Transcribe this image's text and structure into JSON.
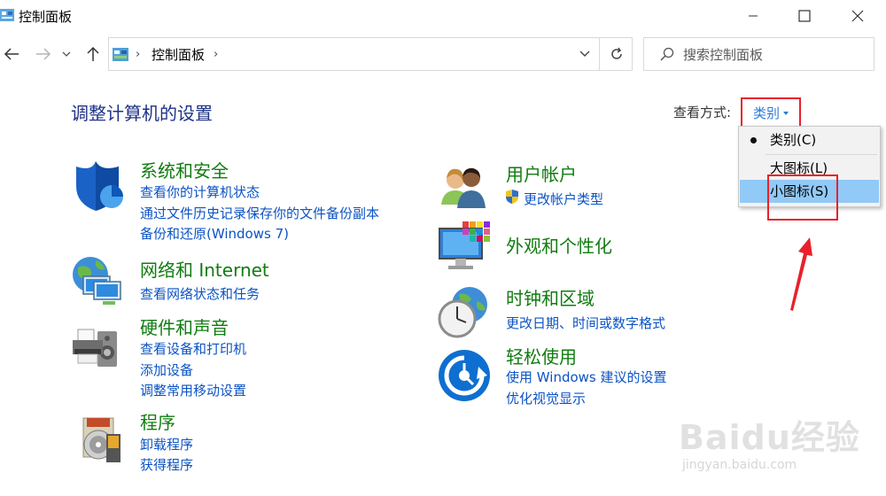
{
  "window": {
    "title": "控制面板"
  },
  "address": {
    "path": "控制面板",
    "search_placeholder": "搜索控制面板"
  },
  "header": {
    "title": "调整计算机的设置",
    "view_by_label": "查看方式:",
    "view_by_value": "类别"
  },
  "view_menu": {
    "items": [
      {
        "label": "类别(C)",
        "checked": true
      },
      {
        "label": "大图标(L)",
        "checked": false
      },
      {
        "label": "小图标(S)",
        "checked": false,
        "hovered": true
      }
    ]
  },
  "categories_left": [
    {
      "title": "系统和安全",
      "icon": "shield-icon",
      "links": [
        "查看你的计算机状态",
        "通过文件历史记录保存你的文件备份副本",
        "备份和还原(Windows 7)"
      ]
    },
    {
      "title": "网络和 Internet",
      "icon": "network-globe-icon",
      "links": [
        "查看网络状态和任务"
      ]
    },
    {
      "title": "硬件和声音",
      "icon": "printer-icon",
      "links": [
        "查看设备和打印机",
        "添加设备",
        "调整常用移动设置"
      ]
    },
    {
      "title": "程序",
      "icon": "programs-disc-icon",
      "links": [
        "卸载程序",
        "获得程序"
      ]
    }
  ],
  "categories_right": [
    {
      "title": "用户帐户",
      "icon": "users-icon",
      "links": [
        "更改帐户类型"
      ]
    },
    {
      "title": "外观和个性化",
      "icon": "monitor-palette-icon",
      "links": []
    },
    {
      "title": "时钟和区域",
      "icon": "clock-globe-icon",
      "links": [
        "更改日期、时间或数字格式"
      ]
    },
    {
      "title": "轻松使用",
      "icon": "ease-of-access-icon",
      "links": [
        "使用 Windows 建议的设置",
        "优化视觉显示"
      ]
    }
  ],
  "watermark": {
    "logo": "Baidu经验",
    "url": "jingyan.baidu.com"
  },
  "colors": {
    "category_title": "#107c10",
    "link": "#0b53c4",
    "heading": "#1e3287",
    "annotation_red": "#e8212b",
    "menu_hover": "#91c9f7"
  }
}
